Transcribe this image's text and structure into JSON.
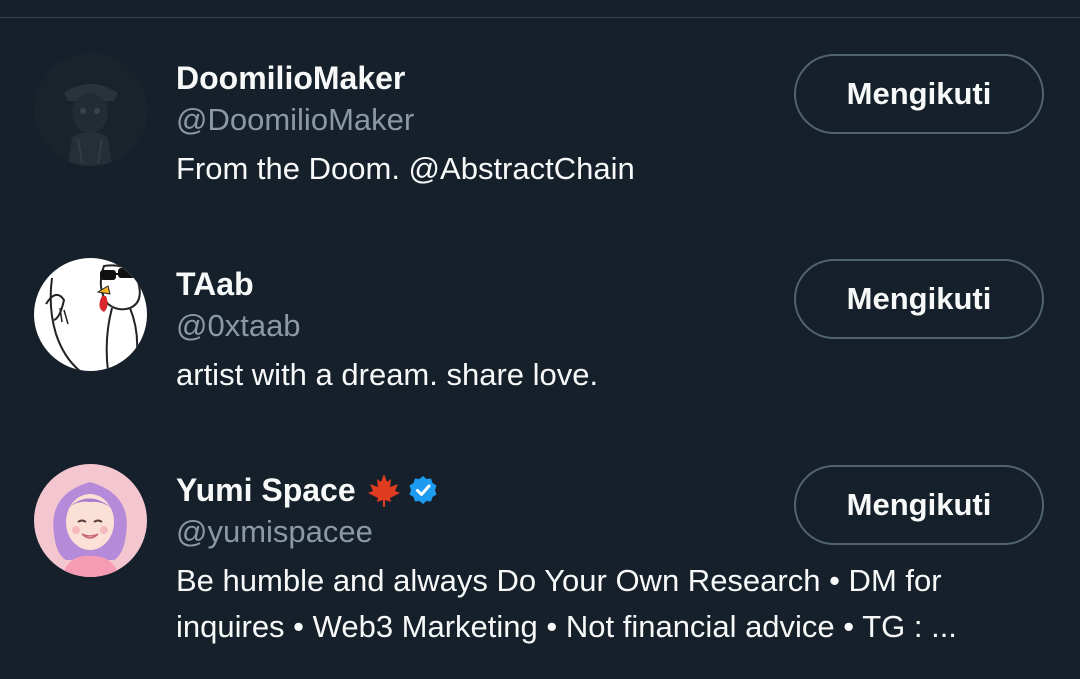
{
  "users": [
    {
      "display_name": "DoomilioMaker",
      "handle": "@DoomilioMaker",
      "bio": "From the Doom. @AbstractChain",
      "follow_label": "Mengikuti",
      "avatar": "dark-character-avatar"
    },
    {
      "display_name": "TAab",
      "handle": "@0xtaab",
      "bio": "artist with a dream. share love.",
      "follow_label": "Mengikuti",
      "avatar": "chicken-sketch-avatar"
    },
    {
      "display_name": "Yumi Space",
      "handle": "@yumispacee",
      "bio": "Be humble and always Do Your Own Research • DM for inquires • Web3 Marketing • Not financial advice • TG : ...",
      "follow_label": "Mengikuti",
      "avatar": "purple-hair-girl-avatar",
      "name_icons": [
        "maple-leaf-icon",
        "verified-badge-icon"
      ]
    }
  ],
  "colors": {
    "background": "#15202b",
    "text_primary": "#f7f9f9",
    "text_secondary": "#8b98a5",
    "button_border": "#536471",
    "verified": "#1d9bf0",
    "maple": "#e03c1f"
  }
}
